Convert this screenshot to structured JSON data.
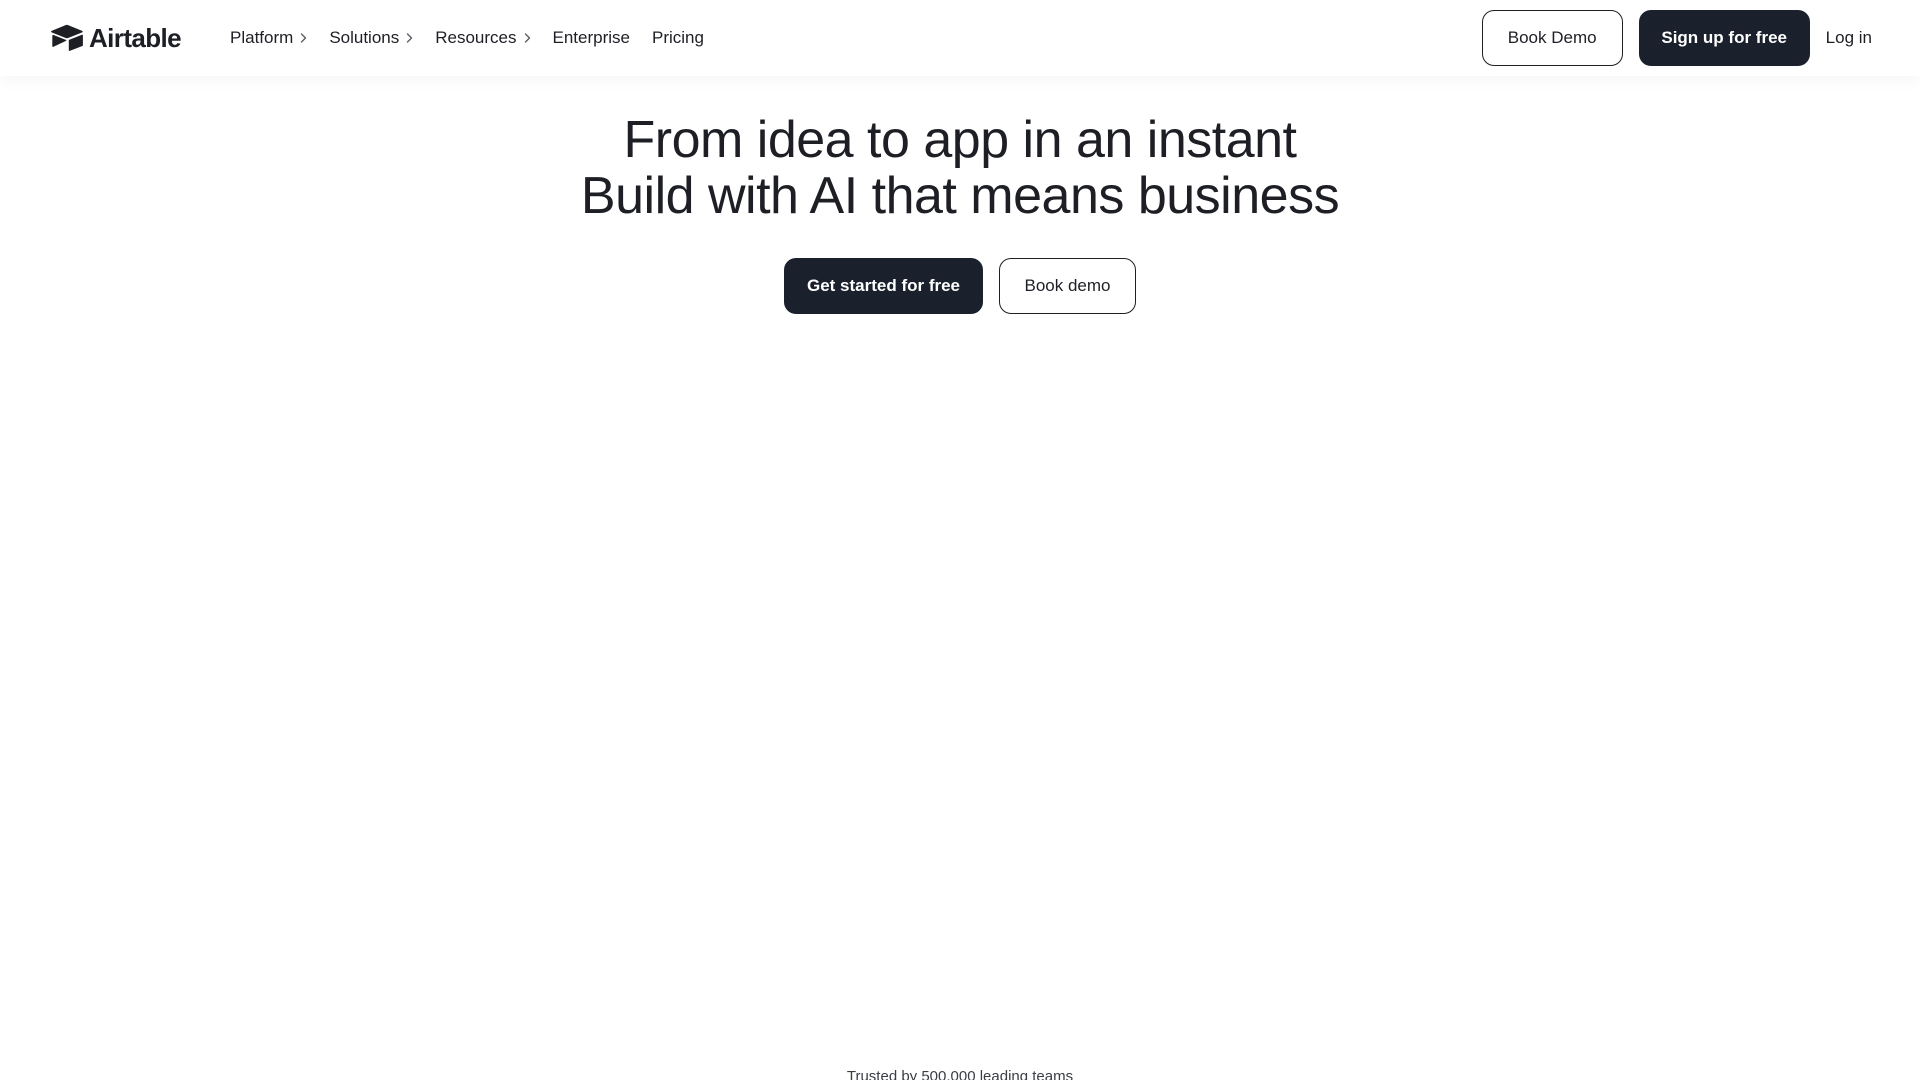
{
  "brand": {
    "name": "Airtable",
    "logo_icon": "airtable-box-logo",
    "color_dark": "#1a202c"
  },
  "nav": {
    "items": [
      {
        "label": "Platform",
        "has_submenu": true
      },
      {
        "label": "Solutions",
        "has_submenu": true
      },
      {
        "label": "Resources",
        "has_submenu": true
      },
      {
        "label": "Enterprise",
        "has_submenu": false
      },
      {
        "label": "Pricing",
        "has_submenu": false
      }
    ],
    "submenu_icon": "chevron-right-icon"
  },
  "header_actions": {
    "book_demo": "Book Demo",
    "sign_up": "Sign up for free",
    "log_in": "Log in"
  },
  "hero": {
    "headline_line1": "From idea to app in an instant",
    "headline_line2": "Build with AI that means business",
    "primary_cta": "Get started for free",
    "secondary_cta": "Book demo"
  },
  "trusted": "Trusted by 500,000 leading teams"
}
